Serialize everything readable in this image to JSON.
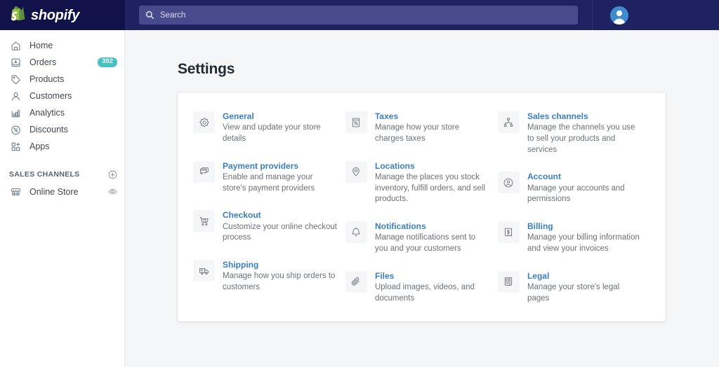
{
  "topbar": {
    "brand_name": "shopify",
    "brand_icon": "shopify-bag-icon",
    "search_placeholder": "Search",
    "search_value": "",
    "search_icon": "search-icon",
    "avatar_icon": "user-avatar-icon"
  },
  "sidebar": {
    "items": [
      {
        "label": "Home",
        "icon": "home-icon",
        "badge": ""
      },
      {
        "label": "Orders",
        "icon": "orders-inbox-icon",
        "badge": "392"
      },
      {
        "label": "Products",
        "icon": "tag-icon",
        "badge": ""
      },
      {
        "label": "Customers",
        "icon": "person-icon",
        "badge": ""
      },
      {
        "label": "Analytics",
        "icon": "bar-chart-icon",
        "badge": ""
      },
      {
        "label": "Discounts",
        "icon": "discount-percent-icon",
        "badge": ""
      },
      {
        "label": "Apps",
        "icon": "apps-grid-plus-icon",
        "badge": ""
      }
    ],
    "section": {
      "title": "SALES CHANNELS",
      "add_icon": "plus-circle-icon"
    },
    "channels": [
      {
        "label": "Online Store",
        "icon": "storefront-icon",
        "action_icon": "eye-icon"
      }
    ]
  },
  "main": {
    "page_title": "Settings",
    "columns": [
      [
        {
          "title": "General",
          "desc": "View and update your store details",
          "icon": "gear-icon"
        },
        {
          "title": "Payment providers",
          "desc": "Enable and manage your store's payment providers",
          "icon": "payment-card-icon"
        },
        {
          "title": "Checkout",
          "desc": "Customize your online checkout process",
          "icon": "shopping-cart-icon"
        },
        {
          "title": "Shipping",
          "desc": "Manage how you ship orders to customers",
          "icon": "truck-icon"
        }
      ],
      [
        {
          "title": "Taxes",
          "desc": "Manage how your store charges taxes",
          "icon": "taxes-document-icon"
        },
        {
          "title": "Locations",
          "desc": "Manage the places you stock inventory, fulfill orders, and sell products.",
          "icon": "location-pin-icon"
        },
        {
          "title": "Notifications",
          "desc": "Manage notifications sent to you and your customers",
          "icon": "bell-icon"
        },
        {
          "title": "Files",
          "desc": "Upload images, videos, and documents",
          "icon": "paperclip-icon"
        }
      ],
      [
        {
          "title": "Sales channels",
          "desc": "Manage the channels you use to sell your products and services",
          "icon": "sales-channels-network-icon"
        },
        {
          "title": "Account",
          "desc": "Manage your accounts and permissions",
          "icon": "account-circle-icon"
        },
        {
          "title": "Billing",
          "desc": "Manage your billing information and view your invoices",
          "icon": "billing-receipt-icon"
        },
        {
          "title": "Legal",
          "desc": "Manage your store's legal pages",
          "icon": "legal-document-icon"
        }
      ]
    ]
  },
  "colors": {
    "topbar_bg": "#1f2260",
    "brand_bg": "#12124a",
    "search_bg": "#474b8c",
    "link_blue": "#3a7ec0",
    "badge_teal": "#47c1bf",
    "page_bg": "#f4f6f8",
    "bag_green": "#95bf47"
  }
}
